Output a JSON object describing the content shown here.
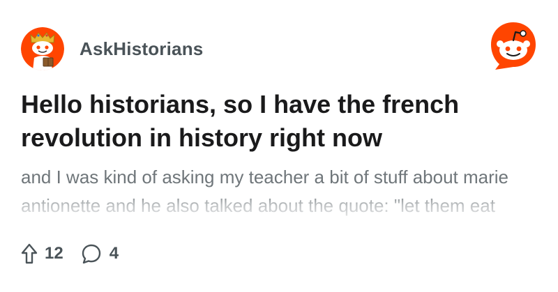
{
  "subreddit": {
    "name": "AskHistorians",
    "avatar_icon": "askhistorians-snoo-avatar-icon"
  },
  "brand": {
    "logo_icon": "reddit-logo-icon",
    "accent": "#ff4500"
  },
  "post": {
    "title": "Hello historians, so I have the french revolution in history right now",
    "body": "and I was kind of asking my teacher a bit of stuff about marie antionette and he also talked about the quote: \"let them eat cake\". Now you hear the sea said that there is"
  },
  "actions": {
    "upvote_icon": "upvote-arrow-icon",
    "upvote_count": "12",
    "comment_icon": "comment-bubble-icon",
    "comment_count": "4"
  }
}
